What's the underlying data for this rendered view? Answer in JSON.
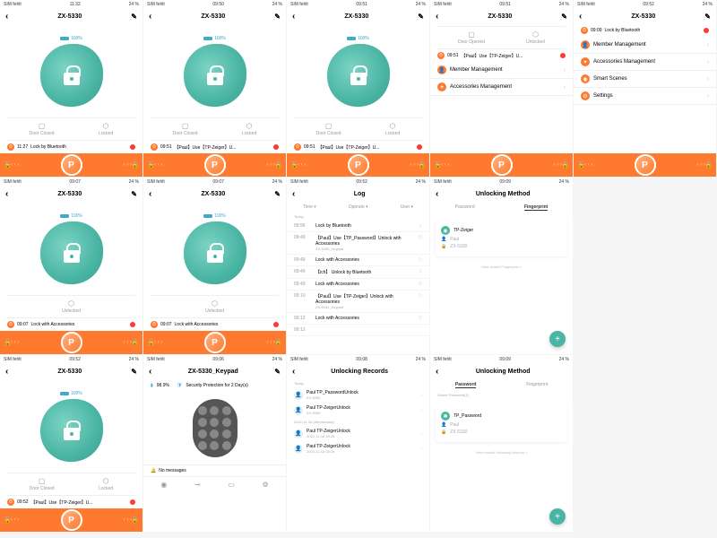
{
  "carrier": "SIM fehlt",
  "wifi": "▲",
  "batt_pct": "24 %",
  "device": "ZX-5330",
  "keypad_device": "ZX-5330_Keypad",
  "batt_label": "100%",
  "status": {
    "door_closed": "Door Closed",
    "door_opened": "Door Opened",
    "locked": "Locked",
    "unlocked": "Unlocked"
  },
  "times": {
    "t1": "11:32",
    "t2": "09:50",
    "t3": "09:51",
    "t4": "09:51",
    "t5": "09:52",
    "t6": "09:52",
    "t7": "09:52",
    "t8": "09:06",
    "t9": "09:07",
    "t10": "09:08",
    "t11": "09:09"
  },
  "logs": {
    "l1": {
      "time": "11:27",
      "text": "Lock by Bluetooth"
    },
    "l2": {
      "time": "09:51",
      "text": "【Paul】Use【TP-Zeiger】U..."
    },
    "l3": {
      "time": "09:51",
      "text": "【Paul】Use【TP-Zeiger】U..."
    },
    "l4": {
      "time": "09:07",
      "text": "Lock with Accessories"
    },
    "l5": {
      "time": "09:07",
      "text": "Lock with Accessories"
    },
    "l6": {
      "time": "09:52",
      "text": "【Paul】Use【TP-Zeiger】U..."
    },
    "l7": {
      "time": "09:09",
      "text": "Lock by Bluetooth"
    }
  },
  "menu": {
    "member": "Member Management",
    "accessories": "Accessories Management",
    "scenes": "Smart Scenes",
    "settings": "Settings"
  },
  "log_screen": {
    "title": "Log",
    "tabs": [
      "Time ▾",
      "Operate ▾",
      "User ▾"
    ],
    "today": "Today",
    "items": [
      {
        "time": "09:56",
        "text": "Lock by Bluetooth"
      },
      {
        "time": "09:49",
        "text": "【Paul】Use【TP_Password】Unlock with Accessories",
        "sub": "ZX-5330_Keypad"
      },
      {
        "time": "09:49",
        "text": "Lock with Accessories"
      },
      {
        "time": "09:49",
        "text": "【ich】 Unlock by Bluetooth"
      },
      {
        "time": "09:49",
        "text": "Lock with Accessories"
      },
      {
        "time": "09:10",
        "text": "【Paul】Use【TP-Zeiger】Unlock with Accessories",
        "sub": "ZX-5330_Keypad"
      },
      {
        "time": "09:12",
        "text": "Lock with Accessories"
      },
      {
        "time": "09:12",
        "text": ""
      }
    ]
  },
  "unlock_method": {
    "title": "Unlocking Method",
    "pwd": "Password",
    "fp": "Fingerprint",
    "fp_name": "TP-Zeiger",
    "fp_user": "Paul",
    "fp_device": "ZX-5330",
    "invalid": "View Invalid Fingerprint >",
    "pwd_name": "TP_Password",
    "online_pwd": "Online Password(1)",
    "invalid_pwd": "View Invalid Unlocking Method >"
  },
  "keypad": {
    "batt": "98.9%",
    "security": "Security Protection for 2 Day(s)",
    "no_msg": "No messages"
  },
  "records": {
    "title": "Unlocking Records",
    "today": "Today",
    "date": "2022-11-16 (Wednesday)",
    "items": [
      {
        "name": "Paul TP_PasswordUnlock",
        "sub": "ZX-5330"
      },
      {
        "name": "Paul TP-ZeigerUnlock",
        "sub": "ZX-5330"
      },
      {
        "name": "Paul TP-ZeigerUnlock",
        "sub": "2022-11-16 18:25"
      },
      {
        "name": "Paul TP-ZeigerUnlock",
        "sub": "2022-11-16 18:25"
      }
    ]
  }
}
